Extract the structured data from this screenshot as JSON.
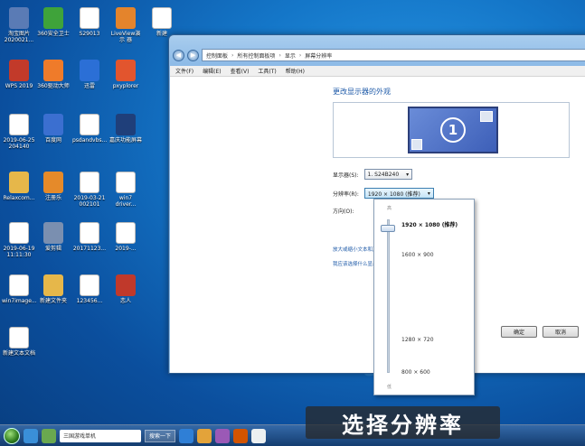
{
  "desktop_icons": [
    {
      "label": "淘宝图片 2020021...",
      "color": "#5a7bb5"
    },
    {
      "label": "360安全卫士",
      "color": "#3fa33a"
    },
    {
      "label": "S29013",
      "color": "#ffffff"
    },
    {
      "label": "LiveView演示 器",
      "color": "#e4842c"
    },
    {
      "label": "新建",
      "color": "#ffffff"
    },
    {
      "label": "WPS 2019",
      "color": "#c23a2a"
    },
    {
      "label": "360驱动大师",
      "color": "#ef7b2a"
    },
    {
      "label": "迅雷",
      "color": "#2b6fd6"
    },
    {
      "label": "pxyplorer",
      "color": "#e2552e"
    },
    {
      "label": "20171123...",
      "color": "#ffffff"
    },
    {
      "label": "2019-06-25 204140",
      "color": "#ffffff"
    },
    {
      "label": "百度网",
      "color": "#3b6fd0"
    },
    {
      "label": "psdandvbs...",
      "color": "#ffffff"
    },
    {
      "label": "嘉庆功能屏幕",
      "color": "#1f3f7a"
    },
    {
      "label": "2019-06-21 1113",
      "color": "#ffffff"
    },
    {
      "label": "Relaxcom...",
      "color": "#e6b74a"
    },
    {
      "label": "注册乐",
      "color": "#e58a2a"
    },
    {
      "label": "2019-03-21 002101",
      "color": "#ffffff"
    },
    {
      "label": "win7 driver...",
      "color": "#ffffff"
    },
    {
      "label": "宽带连接",
      "color": "#2a5fb8"
    },
    {
      "label": "2019-06-19 11:11:30",
      "color": "#ffffff"
    },
    {
      "label": "爱剪辑",
      "color": "#7a8fb0"
    },
    {
      "label": "20171123...",
      "color": "#ffffff"
    },
    {
      "label": "2019-...",
      "color": "#ffffff"
    },
    {
      "label": "微信",
      "color": "#2fb24a"
    },
    {
      "label": "win7image...",
      "color": "#ffffff"
    },
    {
      "label": "新建文件夹",
      "color": "#e6b74a"
    },
    {
      "label": "123456...",
      "color": "#ffffff"
    },
    {
      "label": "恋人",
      "color": "#c0392b"
    },
    {
      "label": "个人简历",
      "color": "#ffffff"
    },
    {
      "label": "新建文本文档",
      "color": "#ffffff"
    }
  ],
  "window": {
    "nav": {
      "back": "◀",
      "forward": "▶"
    },
    "breadcrumb": [
      "控制面板",
      "所有控制面板项",
      "显示",
      "屏幕分辨率"
    ],
    "menu": [
      "文件(F)",
      "编辑(E)",
      "查看(V)",
      "工具(T)",
      "帮助(H)"
    ],
    "heading": "更改显示器的外观",
    "monitor_number": "1",
    "display_label": "显示器(S):",
    "display_value": "1. S24B240",
    "resolution_label": "分辨率(R):",
    "resolution_value": "1920 × 1080 (推荐)",
    "orientation_label": "方向(O):",
    "link1": "放大或缩小文本和其他项目",
    "link2": "我应该选择什么显示器设置?",
    "ok_label": "确定",
    "cancel_label": "取消"
  },
  "dropdown": {
    "high_label": "高",
    "low_label": "低",
    "options": [
      "1920 × 1080 (推荐)",
      "1600 × 900",
      "1280 × 720",
      "800 × 600"
    ],
    "selected": "1920 × 1080 (推荐)"
  },
  "taskbar": {
    "search_text": "三国游戏单机",
    "button_label": "搜索一下"
  },
  "caption": "选择分辨率"
}
